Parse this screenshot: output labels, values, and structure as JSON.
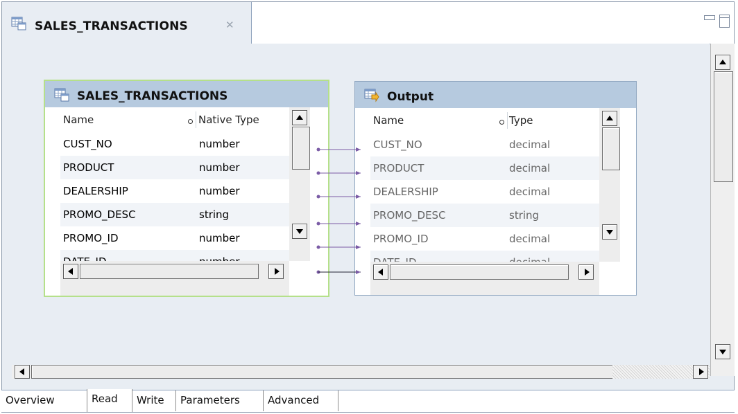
{
  "editor_tab": {
    "title": "SALES_TRANSACTIONS",
    "close_glyph": "✕",
    "icon": "table-icon"
  },
  "window_controls": {
    "minimize_icon": "minimize-icon",
    "maximize_icon": "maximize-icon"
  },
  "source": {
    "title": "SALES_TRANSACTIONS",
    "icon": "table-icon",
    "col_name": "Name",
    "col_type": "Native Type",
    "rows": [
      {
        "name": "CUST_NO",
        "type": "number"
      },
      {
        "name": "PRODUCT",
        "type": "number"
      },
      {
        "name": "DEALERSHIP",
        "type": "number"
      },
      {
        "name": "PROMO_DESC",
        "type": "string"
      },
      {
        "name": "PROMO_ID",
        "type": "number"
      },
      {
        "name": "DATE_ID",
        "type": "number"
      }
    ]
  },
  "output": {
    "title": "Output",
    "icon": "output-table-icon",
    "col_name": "Name",
    "col_type": "Type",
    "rows": [
      {
        "name": "CUST_NO",
        "type": "decimal"
      },
      {
        "name": "PRODUCT",
        "type": "decimal"
      },
      {
        "name": "DEALERSHIP",
        "type": "decimal"
      },
      {
        "name": "PROMO_DESC",
        "type": "string"
      },
      {
        "name": "PROMO_ID",
        "type": "decimal"
      },
      {
        "name": "DATE_ID",
        "type": "decimal"
      }
    ]
  },
  "colors": {
    "source_border": "#b5e08a",
    "output_border": "#8fa6c0",
    "header_bg": "#b6cadf",
    "link_color": "#7b5ca6"
  },
  "bottom_tabs": [
    {
      "label": "Overview",
      "active": false
    },
    {
      "label": "Read",
      "active": true
    },
    {
      "label": "Write",
      "active": false
    },
    {
      "label": "Parameters",
      "active": false
    },
    {
      "label": "Advanced",
      "active": false
    }
  ]
}
